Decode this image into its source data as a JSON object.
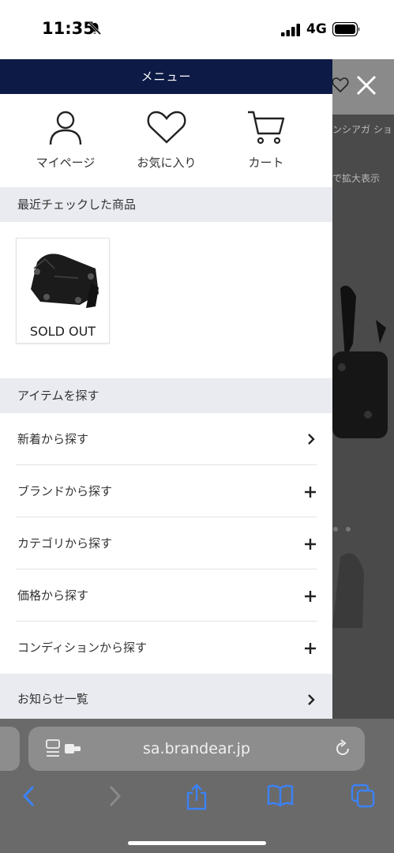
{
  "status_bar": {
    "time": "11:35",
    "network": "4G"
  },
  "background_page": {
    "brand_text": "ンシアガ ショ",
    "zoom_text": "で拡大表示"
  },
  "drawer": {
    "title": "メニュー",
    "quick_links": [
      {
        "label": "マイページ",
        "icon": "person-icon"
      },
      {
        "label": "お気に入り",
        "icon": "heart-icon"
      },
      {
        "label": "カート",
        "icon": "cart-icon"
      }
    ],
    "recent_header": "最近チェックした商品",
    "recent_product": {
      "status": "SOLD OUT"
    },
    "browse_header": "アイテムを探す",
    "browse_items": [
      {
        "label": "新着から探す",
        "icon": "chevron-right-icon"
      },
      {
        "label": "ブランドから探す",
        "icon": "plus-icon"
      },
      {
        "label": "カテゴリから探す",
        "icon": "plus-icon"
      },
      {
        "label": "価格から探す",
        "icon": "plus-icon"
      },
      {
        "label": "コンディションから探す",
        "icon": "plus-icon"
      }
    ],
    "news_label": "お知らせ一覧"
  },
  "browser": {
    "url": "sa.brandear.jp"
  },
  "colors": {
    "header_navy": "#0d1a45",
    "section_gray": "#e9ebf0",
    "ios_blue": "#3b82f6"
  }
}
